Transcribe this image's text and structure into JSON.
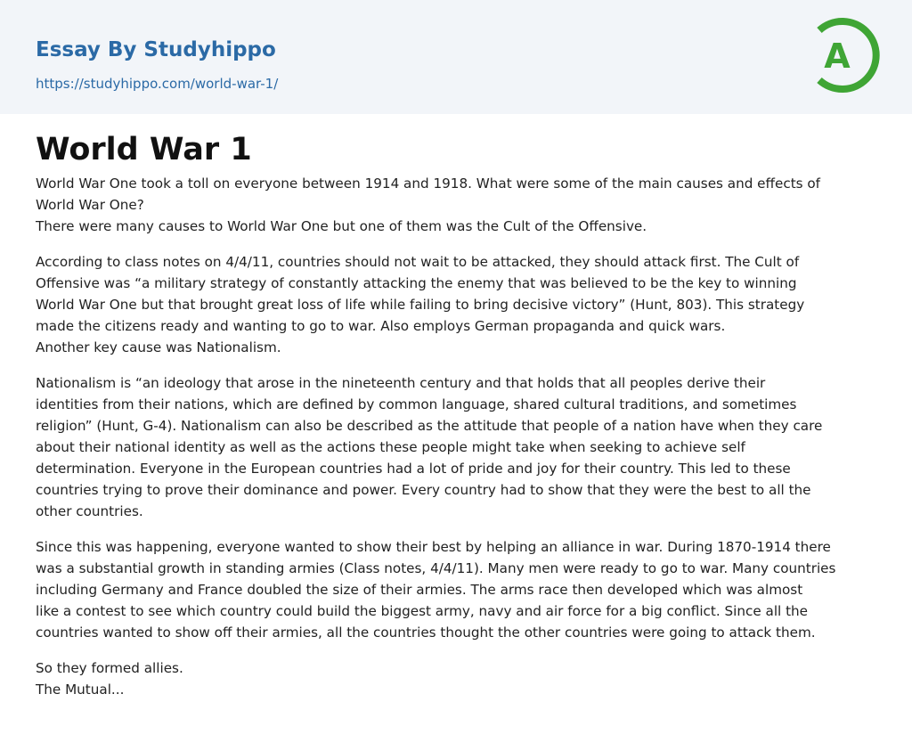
{
  "header": {
    "brand_title": "Essay By Studyhippo",
    "url": "https://studyhippo.com/world-war-1/",
    "logo_letter": "A",
    "logo_color": "#3fa535"
  },
  "article": {
    "title": "World War 1",
    "paragraphs": [
      [
        "World War One took a toll on everyone between 1914 and 1918. What were some of the main causes and effects of",
        "World War One?",
        "There were many causes to World War One but one of them was the Cult of the Offensive."
      ],
      [
        "According to class notes on 4/4/11, countries should not wait to be attacked, they should attack first. The Cult of",
        "Offensive was “a military strategy of constantly attacking the enemy that was believed to be the key to winning",
        "World War One but that brought great loss of life while failing to bring decisive victory” (Hunt, 803). This strategy",
        "made the citizens ready and wanting to go to war. Also employs German propaganda and quick wars.",
        "Another key cause was Nationalism."
      ],
      [
        "Nationalism is “an ideology that arose in the nineteenth century and that holds that all peoples derive their",
        "identities from their nations, which are defined by common language, shared cultural traditions, and sometimes",
        "religion” (Hunt, G-4). Nationalism can also be described as the attitude that people of a nation have when they care",
        "about their national identity as well as the actions these people might take when seeking to achieve self",
        "determination. Everyone in the European countries had a lot of pride and joy for their country. This led to these",
        "countries trying to prove their dominance and power. Every country had to show that they were the best to all the",
        "other countries."
      ],
      [
        "Since this was happening, everyone wanted to show their best by helping an alliance in war. During 1870-1914 there",
        "was a substantial growth in standing armies (Class notes, 4/4/11). Many men were ready to go to war. Many countries",
        "including Germany and France doubled the size of their armies. The arms race then developed which was almost",
        "like a contest to see which country could build the biggest army, navy and air force for a big conflict. Since all the",
        "countries wanted to show off their armies, all the countries thought the other countries were going to attack them."
      ],
      [
        "So they formed allies.",
        "The Mutual..."
      ]
    ]
  }
}
